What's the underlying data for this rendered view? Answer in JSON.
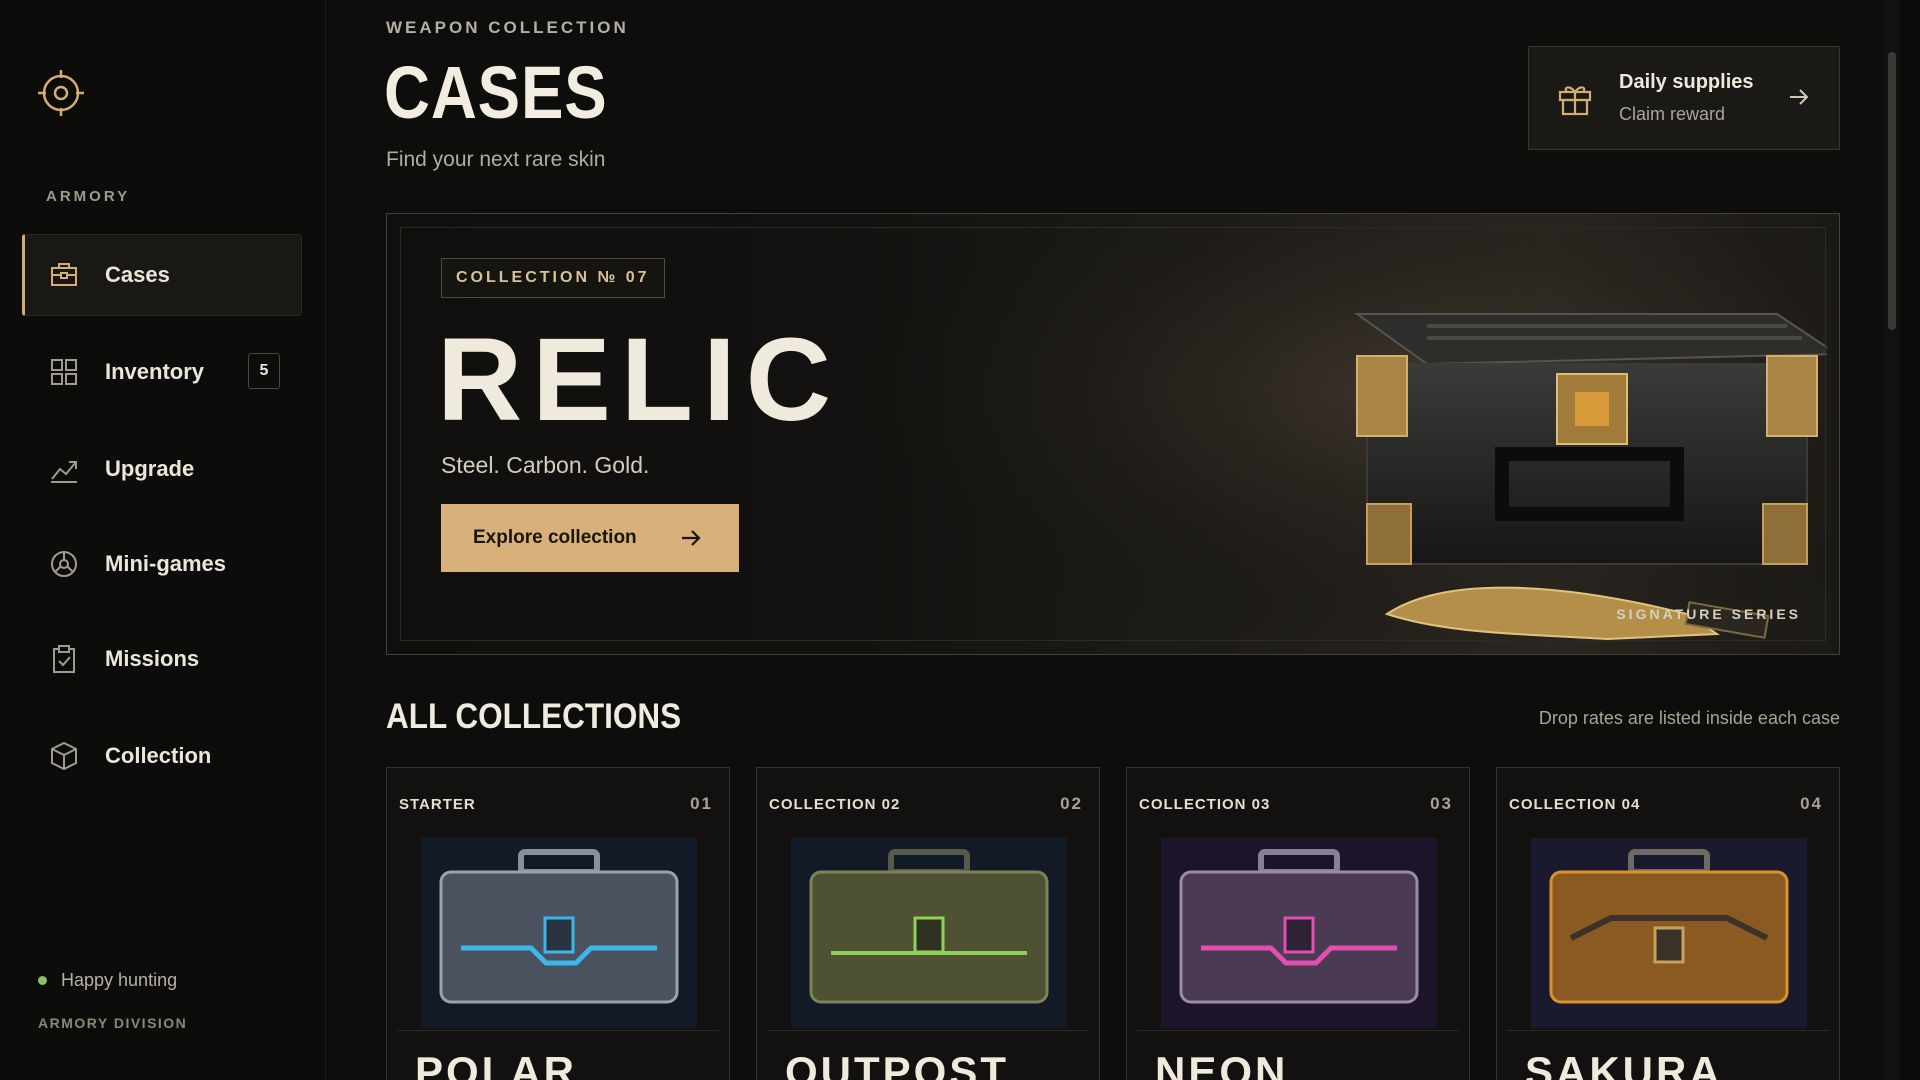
{
  "sidebar": {
    "section_label": "ARMORY",
    "items": [
      {
        "label": "Cases",
        "icon": "briefcase-icon",
        "active": true
      },
      {
        "label": "Inventory",
        "icon": "grid-icon",
        "badge": "5"
      },
      {
        "label": "Upgrade",
        "icon": "trend-up-icon"
      },
      {
        "label": "Mini-games",
        "icon": "target-wheel-icon"
      },
      {
        "label": "Missions",
        "icon": "clipboard-icon"
      },
      {
        "label": "Collection",
        "icon": "cube-icon"
      }
    ],
    "status_text": "Happy hunting",
    "division": "ARMORY DIVISION"
  },
  "header": {
    "eyebrow": "WEAPON COLLECTION",
    "title": "CASES",
    "subtitle": "Find your next rare skin"
  },
  "daily": {
    "title": "Daily supplies",
    "subtitle": "Claim reward"
  },
  "hero": {
    "tag": "COLLECTION № 07",
    "title": "RELIC",
    "subtitle": "Steel. Carbon. Gold.",
    "button": "Explore collection",
    "signature": "SIGNATURE SERIES"
  },
  "collections": {
    "title": "ALL COLLECTIONS",
    "note": "Drop rates are listed inside each case",
    "cards": [
      {
        "label": "STARTER",
        "num": "01",
        "name": "POLAR",
        "accent": "#3fb6e8"
      },
      {
        "label": "COLLECTION 02",
        "num": "02",
        "name": "OUTPOST",
        "accent": "#8fd05a"
      },
      {
        "label": "COLLECTION 03",
        "num": "03",
        "name": "NEON",
        "accent": "#e24fb0"
      },
      {
        "label": "COLLECTION 04",
        "num": "04",
        "name": "SAKURA",
        "accent": "#d8922e"
      }
    ]
  },
  "colors": {
    "accent_gold": "#d7b07a",
    "background": "#0d0d0c"
  }
}
